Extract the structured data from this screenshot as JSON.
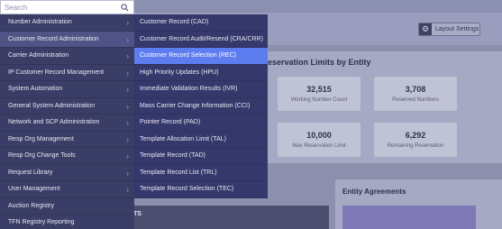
{
  "search": {
    "placeholder": "Search"
  },
  "header": {
    "layout_settings_label": "Layout Settings"
  },
  "menu": {
    "items": [
      {
        "label": "Number Administration",
        "has_sub": true
      },
      {
        "label": "Customer Record Administration",
        "has_sub": true
      },
      {
        "label": "Carrier Administration",
        "has_sub": true
      },
      {
        "label": "IP Customer Record Management",
        "has_sub": true
      },
      {
        "label": "System Automation",
        "has_sub": true
      },
      {
        "label": "General System Administration",
        "has_sub": true
      },
      {
        "label": "Network and SCP Administration",
        "has_sub": true
      },
      {
        "label": "Resp Org Management",
        "has_sub": true
      },
      {
        "label": "Resp Org Change Tools",
        "has_sub": true
      },
      {
        "label": "Request Library",
        "has_sub": true
      },
      {
        "label": "User Management",
        "has_sub": true
      },
      {
        "label": "Auction Registry",
        "has_sub": false
      },
      {
        "label": "TFN Registry Reporting",
        "has_sub": false
      }
    ]
  },
  "submenu": {
    "items": [
      {
        "label": "Customer Record (CAD)"
      },
      {
        "label": "Customer Record Audit/Resend (CRA/CRR)"
      },
      {
        "label": "Customer Record Selection (REC)"
      },
      {
        "label": "High Priority Updates (HPU)"
      },
      {
        "label": "Immediate Validation Results (IVR)"
      },
      {
        "label": "Mass Carrier Change Information (CCI)"
      },
      {
        "label": "Pointer Record (PAD)"
      },
      {
        "label": "Template Allocation Limit (TAL)"
      },
      {
        "label": "Template Record (TAD)"
      },
      {
        "label": "Template Record List (TRL)"
      },
      {
        "label": "Template Record Selection (TEC)"
      }
    ]
  },
  "reservation": {
    "title": "eservation Limits by Entity",
    "kpis": [
      {
        "value": "32,515",
        "label": "Working Number Count"
      },
      {
        "value": "3,708",
        "label": "Reserved Numbers"
      },
      {
        "value": "10,000",
        "label": "Max Reservation Limit"
      },
      {
        "value": "6,292",
        "label": "Remaining Reservation"
      }
    ]
  },
  "entity_agreements": {
    "title": "Entity Agreements"
  },
  "left_block_tag": "TS"
}
